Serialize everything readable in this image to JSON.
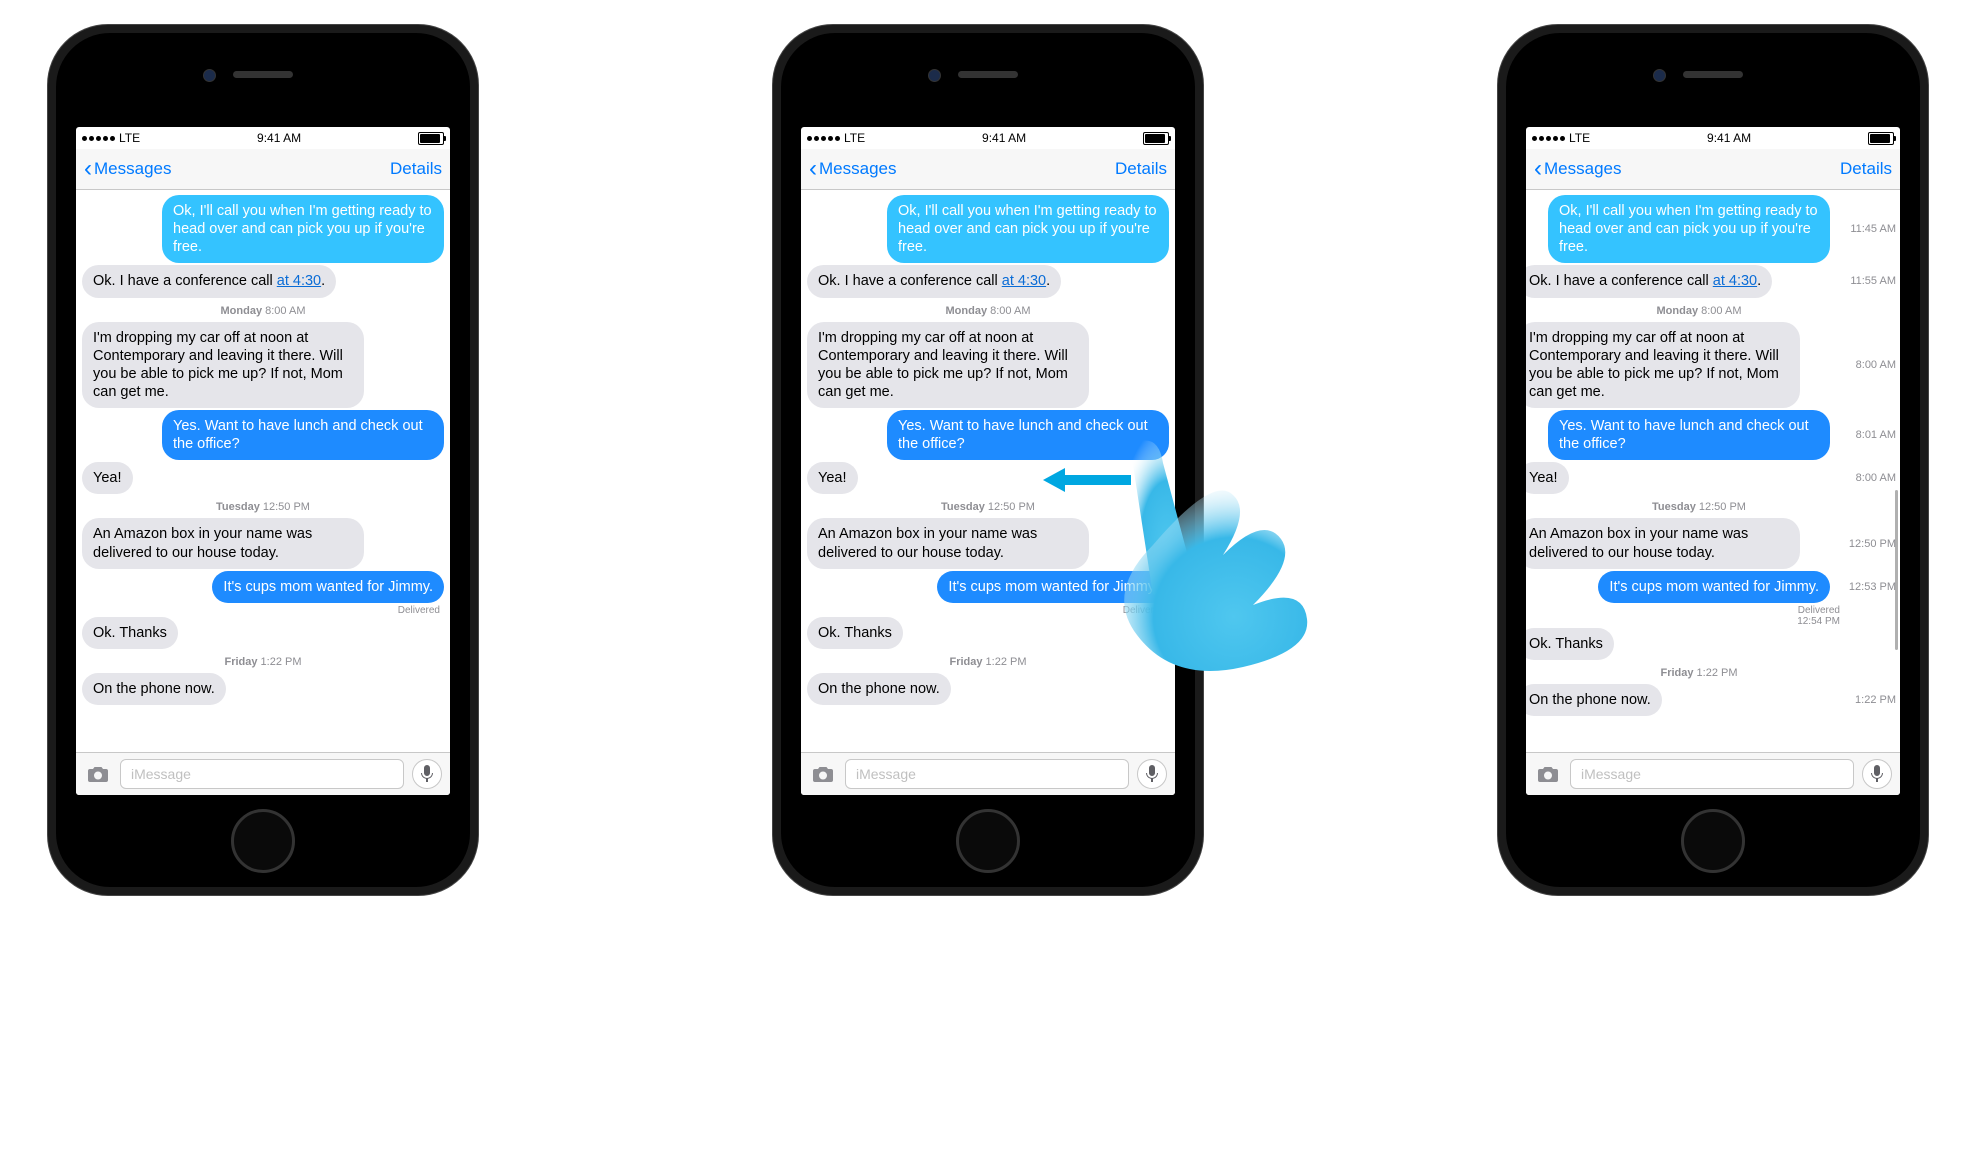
{
  "status": {
    "carrier": "LTE",
    "time": "9:41 AM"
  },
  "nav": {
    "back": "Messages",
    "details": "Details"
  },
  "input": {
    "placeholder": "iMessage"
  },
  "timestamps": {
    "mon": "Monday 8:00 AM",
    "tue": "Tuesday 12:50 PM",
    "fri": "Friday 1:22 PM"
  },
  "delivered": "Delivered",
  "messages": {
    "m1": "Ok, I'll call you when I'm getting ready to head over and can pick you up if you're free.",
    "m2a": "Ok. I have a conference call ",
    "m2b": "at 4:30",
    "m2c": ".",
    "m3": "I'm dropping my car off at noon at Contemporary and leaving it there. Will you be able to pick me up? If not, Mom can get me.",
    "m4": "Yes. Want to have lunch and check out the office?",
    "m5": "Yea!",
    "m6": "An Amazon box in your name was delivered to our house today.",
    "m7": "It's cups mom wanted for Jimmy.",
    "m8": "Ok. Thanks",
    "m9": "On the phone now."
  },
  "side_times": {
    "t1": "11:45 AM",
    "t2": "11:55 AM",
    "t3": "8:00 AM",
    "t4": "8:01 AM",
    "t5": "8:00 AM",
    "t6": "12:50 PM",
    "t7": "12:53 PM",
    "t8": "12:54 PM",
    "t9": "1:22 PM"
  }
}
